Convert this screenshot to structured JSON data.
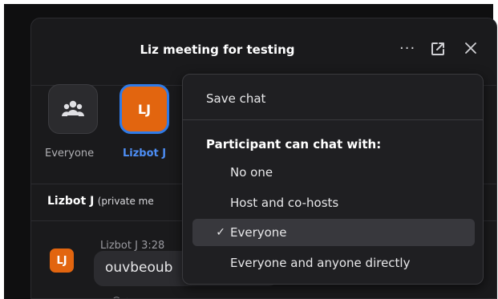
{
  "panel": {
    "title": "Liz meeting for testing"
  },
  "header_icons": {
    "more": "more-dots-icon",
    "popout": "popout-icon",
    "close": "close-icon"
  },
  "participants": {
    "everyone_label": "Everyone",
    "lizbot_initials": "LJ",
    "lizbot_label": "Lizbot J"
  },
  "to_line": {
    "name": "Lizbot J",
    "note": "(private me"
  },
  "message": {
    "sender": "Lizbot J 3:28",
    "avatar_initials": "LJ",
    "text": "ouvbeoub",
    "reaction": "☺ ⁺"
  },
  "menu": {
    "save_chat": "Save chat",
    "heading": "Participant can chat with:",
    "options": [
      {
        "label": "No one",
        "selected": false
      },
      {
        "label": "Host and co-hosts",
        "selected": false
      },
      {
        "label": "Everyone",
        "selected": true
      },
      {
        "label": "Everyone and anyone directly",
        "selected": false
      }
    ],
    "check_glyph": "✓"
  },
  "colors": {
    "accent_blue": "#2f7be8",
    "avatar_orange": "#e2650f",
    "panel_bg": "#1a1a1c",
    "menu_bg": "#1f1f22",
    "selected_bg": "#38383d"
  }
}
